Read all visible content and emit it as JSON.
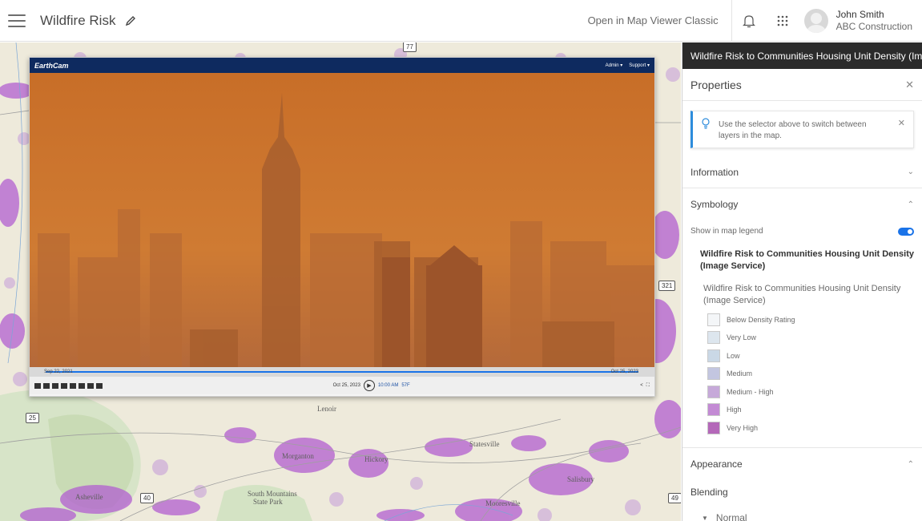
{
  "header": {
    "title": "Wildfire Risk",
    "classic_link": "Open in Map Viewer Classic",
    "user_name": "John Smith",
    "user_org": "ABC Construction"
  },
  "map": {
    "labels": [
      "Asheville",
      "Morganton",
      "Hickory",
      "Statesville",
      "Salisbury",
      "Mooresville",
      "South Mountains",
      "State Park",
      "Lenoir"
    ],
    "shields": [
      "25",
      "40",
      "49",
      "77",
      "321"
    ]
  },
  "video": {
    "brand": "EarthCam",
    "nav_admin": "Admin ▾",
    "nav_support": "Support ▾",
    "timeline_start": "Sep 22, 2021",
    "timeline_end": "Oct 25, 2023",
    "current_date": "Oct 25, 2023",
    "current_time": "10:00 AM",
    "temp": "57F"
  },
  "panel": {
    "layer_selector": "Wildfire Risk to Communities Housing Unit Density (Im",
    "properties_title": "Properties",
    "tip_text": "Use the selector above to switch between layers in the map.",
    "sections": {
      "information": "Information",
      "symbology": "Symbology",
      "appearance": "Appearance"
    },
    "show_in_legend": "Show in map legend",
    "legend_title": "Wildfire Risk to Communities Housing Unit Density (Image Service)",
    "legend_subtitle": "Wildfire Risk to Communities Housing Unit Density (Image Service)",
    "legend_items": [
      {
        "label": "Below Density Rating",
        "color": "#f4f6f8"
      },
      {
        "label": "Very Low",
        "color": "#dde6ee"
      },
      {
        "label": "Low",
        "color": "#cad8e6"
      },
      {
        "label": "Medium",
        "color": "#c3c6e0"
      },
      {
        "label": "Medium - High",
        "color": "#c6a9d9"
      },
      {
        "label": "High",
        "color": "#c38ad4"
      },
      {
        "label": "Very High",
        "color": "#b468b9"
      }
    ],
    "blending_label": "Blending",
    "blending_value": "Normal"
  },
  "colors": {
    "accent": "#1a73e8",
    "haze": "#c8702a",
    "density_purple": "#b25fd0"
  }
}
